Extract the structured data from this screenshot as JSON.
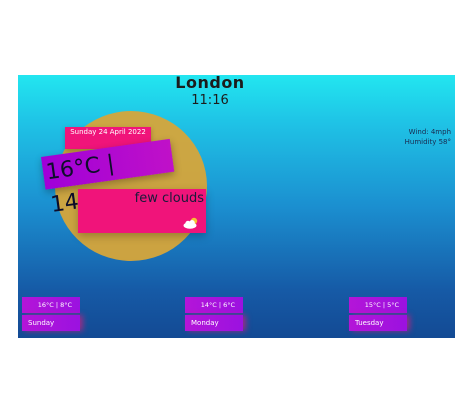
{
  "header": {
    "city": "London",
    "time": "11:16"
  },
  "current": {
    "date": "Sunday 24 April 2022",
    "temperature": "16°C | 14°C",
    "description": "few clouds",
    "wind": "Wind: 4mph",
    "humidity": "Humidity 58°",
    "weather_icon": "few-clouds-icon"
  },
  "forecast": [
    {
      "temp": "16°C | 8°C",
      "day": "Sunday"
    },
    {
      "temp": "14°C | 6°C",
      "day": "Monday"
    },
    {
      "temp": "15°C | 5°C",
      "day": "Tuesday"
    }
  ],
  "colors": {
    "sky_top": "#22e6f0",
    "sky_bottom": "#134a94",
    "sun": "#d6a53a",
    "pink_card": "#f0147a",
    "purple_ribbon": "#a000d8"
  }
}
